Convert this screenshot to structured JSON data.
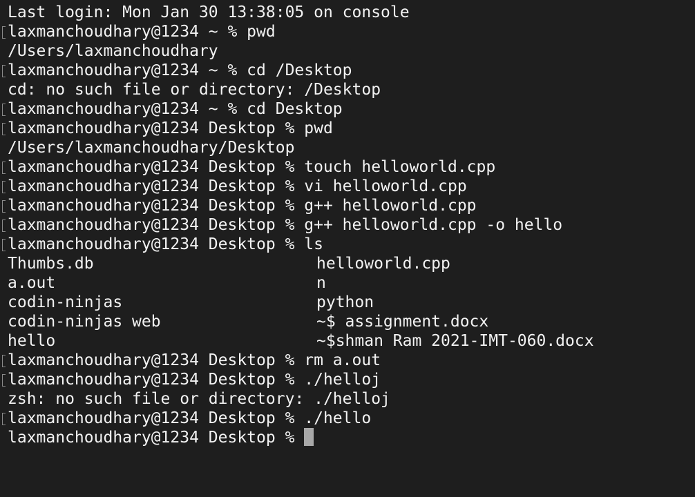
{
  "terminal": {
    "last_login": "Last login: Mon Jan 30 13:38:05 on console",
    "lines": [
      {
        "text": "laxmanchoudhary@1234 ~ % pwd"
      },
      {
        "text": "/Users/laxmanchoudhary"
      },
      {
        "text": "laxmanchoudhary@1234 ~ % cd /Desktop"
      },
      {
        "text": "cd: no such file or directory: /Desktop"
      },
      {
        "text": "laxmanchoudhary@1234 ~ % cd Desktop"
      },
      {
        "text": "laxmanchoudhary@1234 Desktop % pwd"
      },
      {
        "text": "/Users/laxmanchoudhary/Desktop"
      },
      {
        "text": "laxmanchoudhary@1234 Desktop % touch helloworld.cpp"
      },
      {
        "text": "laxmanchoudhary@1234 Desktop % vi helloworld.cpp"
      },
      {
        "text": "laxmanchoudhary@1234 Desktop % g++ helloworld.cpp"
      },
      {
        "text": "laxmanchoudhary@1234 Desktop % g++ helloworld.cpp -o hello"
      },
      {
        "text": "laxmanchoudhary@1234 Desktop % ls"
      }
    ],
    "ls_output": [
      {
        "left": "Thumbs.db",
        "right": "helloworld.cpp"
      },
      {
        "left": "a.out",
        "right": "n"
      },
      {
        "left": "codin-ninjas",
        "right": "python"
      },
      {
        "left": "codin-ninjas web",
        "right": "~$ assignment.docx"
      },
      {
        "left": "hello",
        "right": "~$shman Ram 2021-IMT-060.docx"
      }
    ],
    "after_lines": [
      {
        "text": "laxmanchoudhary@1234 Desktop % rm a.out"
      },
      {
        "text": "laxmanchoudhary@1234 Desktop % ./helloj"
      },
      {
        "text": "zsh: no such file or directory: ./helloj"
      },
      {
        "text": "laxmanchoudhary@1234 Desktop % ./hello"
      }
    ],
    "current_prompt": "laxmanchoudhary@1234 Desktop % ",
    "colors": {
      "background": "#1e1e1e",
      "foreground": "#f2f2f2",
      "cursor": "#a8a8a8"
    }
  }
}
